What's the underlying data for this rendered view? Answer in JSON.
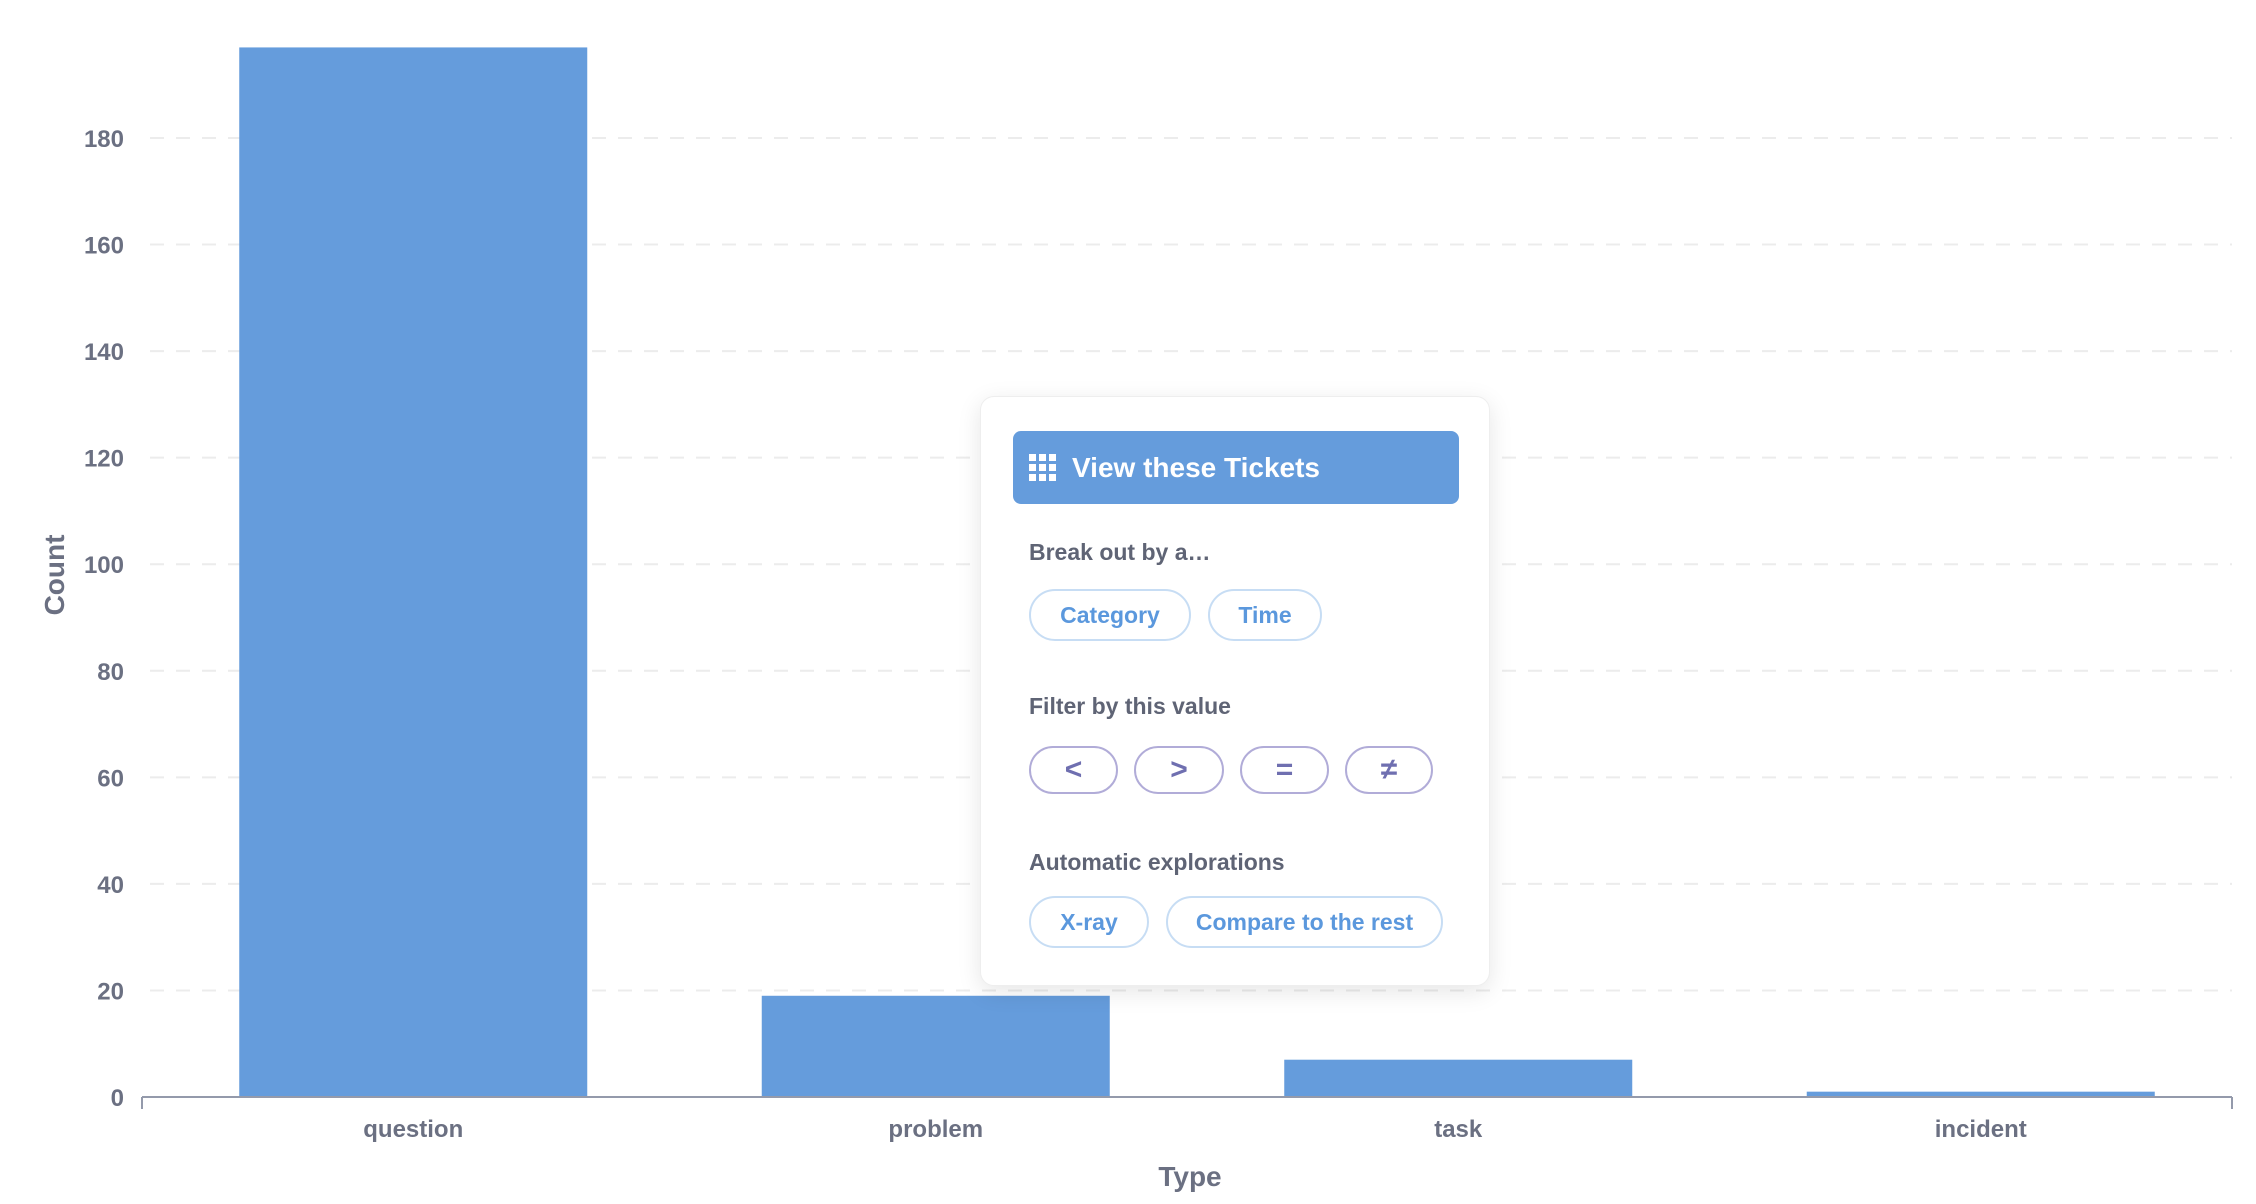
{
  "chart_data": {
    "type": "bar",
    "title": "",
    "xlabel": "Type",
    "ylabel": "Count",
    "categories": [
      "question",
      "problem",
      "task",
      "incident"
    ],
    "values": [
      197,
      19,
      7,
      1
    ],
    "ylim": [
      0,
      200
    ],
    "yticks": [
      0,
      20,
      40,
      60,
      80,
      100,
      120,
      140,
      160,
      180
    ],
    "grid": true,
    "legend": "none",
    "bar_color": "#659cdc"
  },
  "popover": {
    "primary_action": {
      "label": "View these Tickets",
      "icon": "grid-icon"
    },
    "breakout": {
      "label": "Break out by a…",
      "options": [
        "Category",
        "Time"
      ]
    },
    "filter": {
      "label": "Filter by this value",
      "operators": [
        "<",
        ">",
        "=",
        "≠"
      ]
    },
    "explore": {
      "label": "Automatic explorations",
      "options": [
        "X-ray",
        "Compare to the rest"
      ]
    },
    "colors": {
      "accent": "#659cdc",
      "operator": "#6f6fb0"
    }
  }
}
